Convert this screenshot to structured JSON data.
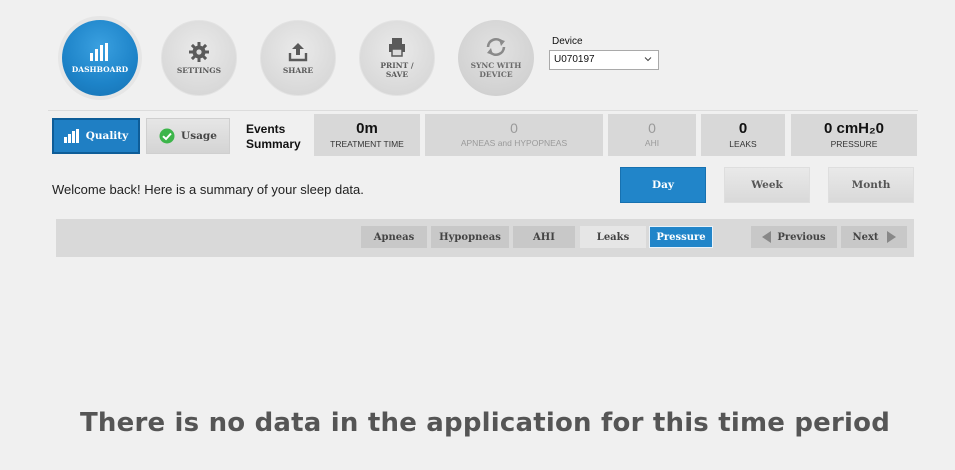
{
  "top_nav": {
    "dashboard": "DASHBOARD",
    "settings": "SETTINGS",
    "share": "SHARE",
    "print_line1": "PRINT /",
    "print_line2": "SAVE",
    "sync_line1": "SYNC WITH",
    "sync_line2": "DEVICE"
  },
  "device": {
    "label": "Device",
    "selected": "U070197"
  },
  "view_toggle": {
    "quality": "Quality",
    "usage": "Usage"
  },
  "events_summary": {
    "line1": "Events",
    "line2": "Summary"
  },
  "stats": [
    {
      "value": "0m",
      "label": "TREATMENT TIME"
    },
    {
      "value": "0",
      "label": "APNEAS and HYPOPNEAS"
    },
    {
      "value": "0",
      "label": "AHI"
    },
    {
      "value": "0",
      "label": "LEAKS"
    },
    {
      "value": "0 cmH₂0",
      "label": "PRESSURE"
    }
  ],
  "welcome": "Welcome back! Here is a summary of your sleep data.",
  "range": {
    "day": "Day",
    "week": "Week",
    "month": "Month",
    "selected": "Day"
  },
  "metrics": {
    "apneas": "Apneas",
    "hypopneas": "Hypopneas",
    "ahi": "AHI",
    "leaks": "Leaks",
    "pressure": "Pressure",
    "selected": "Pressure"
  },
  "pager": {
    "previous": "Previous",
    "next": "Next"
  },
  "empty_message": "There is no data in the application for this time period",
  "colors": {
    "accent": "#2185c9",
    "usage_check": "#3cb54a"
  }
}
